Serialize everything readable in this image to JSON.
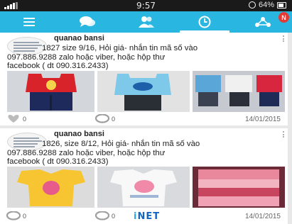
{
  "status_bar": {
    "time": "9:57",
    "battery": "64%"
  },
  "nav": {
    "tabs": [
      {
        "icon": "menu-icon"
      },
      {
        "icon": "chat-bubbles-icon"
      },
      {
        "icon": "contacts-icon"
      },
      {
        "icon": "clock-icon",
        "active": true
      },
      {
        "icon": "network-icon",
        "badge": "N"
      }
    ],
    "accent": "#29b6e0"
  },
  "posts": [
    {
      "author": "quanao bansi",
      "line1": "1827 size 9/16, Hỏi giá-  nhắn tin mã số vào",
      "line2": "097.886.9288 zalo hoặc viber, hoặc hộp thư",
      "line3": "facebook ( dt 090.316.2433)",
      "likes": "0",
      "comments": "0",
      "date": "14/01/2015",
      "photos": [
        "red-tank-set",
        "blue-tank-set",
        "kids-outfits-set"
      ]
    },
    {
      "author": "quanao bansi",
      "line1": "1826, size 8/12, Hỏi giá-  nhắn tin mã số vào",
      "line2": "097.886.9288 zalo hoặc viber, hoặc hộp thư",
      "line3": "facebook ( dt 090.316.2433)",
      "likes": "0",
      "comments": "0",
      "date": "14/01/2015",
      "photos": [
        "yellow-tshirt",
        "white-tshirt",
        "pink-shirts-stack"
      ],
      "watermark_prefix": "i",
      "watermark": "NET"
    }
  ]
}
